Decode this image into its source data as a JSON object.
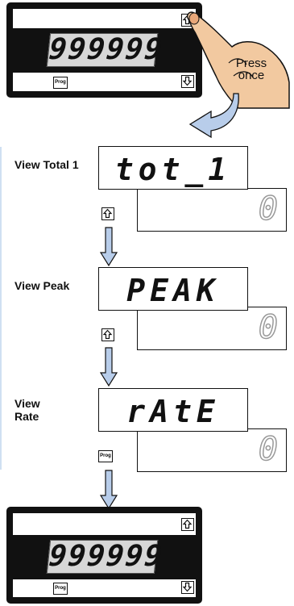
{
  "meter_top": {
    "display": "999999",
    "prog_label": "Prog"
  },
  "callout": {
    "line1": "Press",
    "line2": "once"
  },
  "steps": [
    {
      "label_line1": "View Total 1",
      "label_line2": "",
      "upper": "tot_1",
      "lower": "0",
      "button": "up"
    },
    {
      "label_line1": "View Peak",
      "label_line2": "",
      "upper": "PEAK",
      "lower": "0",
      "button": "up"
    },
    {
      "label_line1": "View",
      "label_line2": "Rate",
      "upper": "rAtE",
      "lower": "0",
      "button": "prog"
    }
  ],
  "step_button_prog_label": "Prog",
  "meter_bottom": {
    "display": "999999",
    "prog_label": "Prog"
  },
  "colors": {
    "meter_body": "#111111",
    "lcd": "#d7d7d7",
    "hand": "#f2c9a0",
    "flow_arrow": "#b8cdea"
  },
  "icons": [
    "up-arrow-key-icon",
    "down-arrow-key-icon",
    "hand-pointer-icon",
    "flow-arrow-icon",
    "down-arrow-icon"
  ]
}
